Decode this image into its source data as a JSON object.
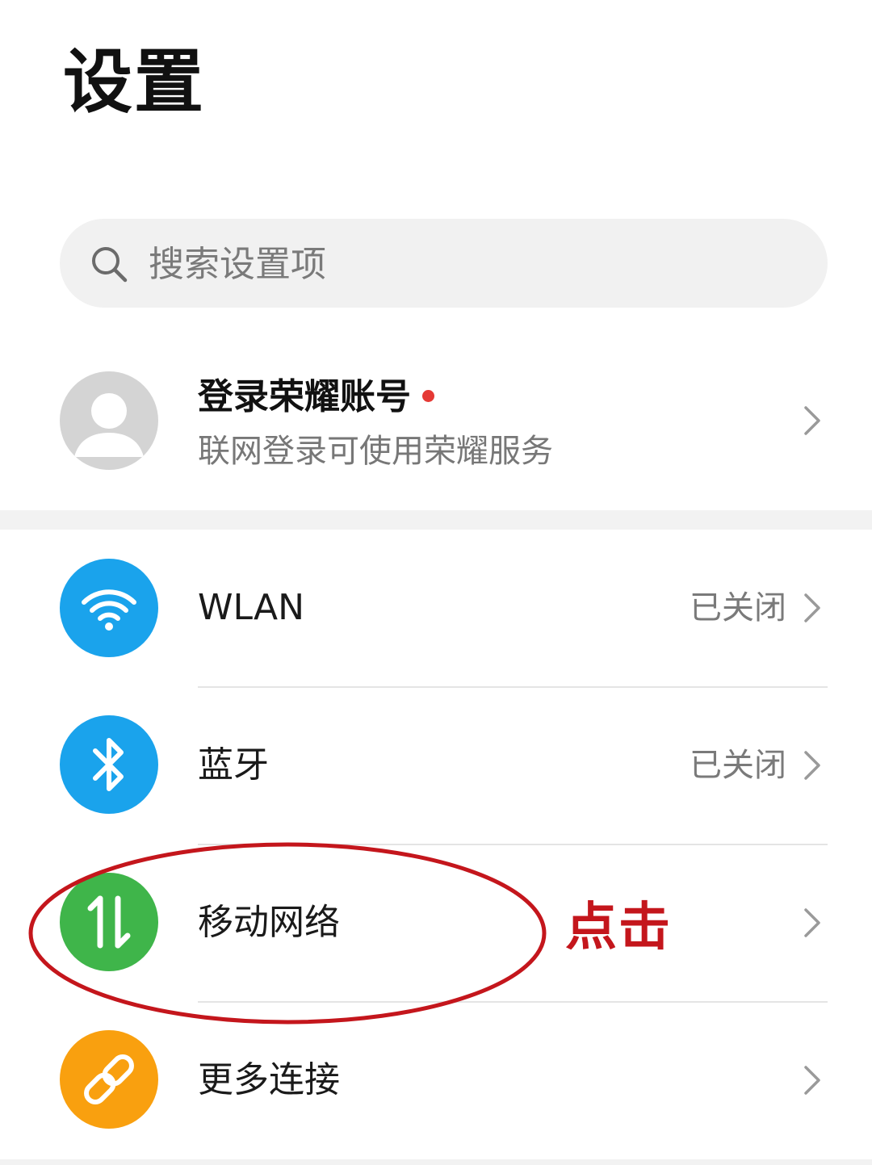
{
  "header": {
    "title": "设置"
  },
  "search": {
    "placeholder": "搜索设置项",
    "icon": "search-icon"
  },
  "account": {
    "title": "登录荣耀账号",
    "subtitle": "联网登录可使用荣耀服务",
    "notification_dot_color": "#e53935"
  },
  "settings": [
    {
      "label": "WLAN",
      "status": "已关闭",
      "icon": "wifi-icon",
      "icon_color": "#1aa3ec"
    },
    {
      "label": "蓝牙",
      "status": "已关闭",
      "icon": "bluetooth-icon",
      "icon_color": "#1aa3ec"
    },
    {
      "label": "移动网络",
      "status": "",
      "icon": "mobile-data-icon",
      "icon_color": "#3fb54a"
    },
    {
      "label": "更多连接",
      "status": "",
      "icon": "link-icon",
      "icon_color": "#f9a00f"
    }
  ],
  "annotation": {
    "text": "点击",
    "color": "#c4161c"
  }
}
